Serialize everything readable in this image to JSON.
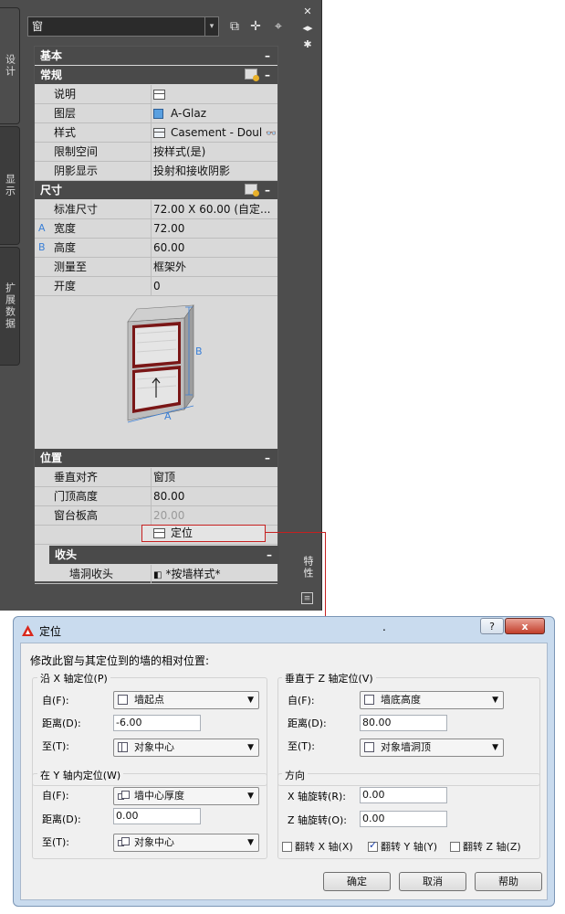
{
  "palette": {
    "type_value": "窗",
    "side_tabs": [
      "设计",
      "显示",
      "扩展数据"
    ],
    "properties_tab": "特性",
    "sections": {
      "basic": "基本",
      "general": "常规",
      "dimensions": "尺寸",
      "location": "位置",
      "sill": "收头"
    },
    "general_rows": [
      {
        "label": "说明",
        "value": ""
      },
      {
        "label": "图层",
        "value": "A-Glaz"
      },
      {
        "label": "样式",
        "value": "Casement - Doul"
      },
      {
        "label": "限制空间",
        "value": "按样式(是)"
      },
      {
        "label": "阴影显示",
        "value": "投射和接收阴影"
      }
    ],
    "dimension_rows": [
      {
        "key": "",
        "label": "标准尺寸",
        "value": "72.00  X  60.00 (自定..."
      },
      {
        "key": "A",
        "label": "宽度",
        "value": "72.00"
      },
      {
        "key": "B",
        "label": "高度",
        "value": "60.00"
      },
      {
        "key": "",
        "label": "测量至",
        "value": "框架外"
      },
      {
        "key": "",
        "label": "开度",
        "value": "0"
      }
    ],
    "preview_labels": {
      "a": "A",
      "b": "B"
    },
    "location_rows": [
      {
        "label": "垂直对齐",
        "value": "窗顶"
      },
      {
        "label": "门顶高度",
        "value": "80.00"
      },
      {
        "label": "窗台板高",
        "value": "20.00"
      }
    ],
    "location_button": "定位",
    "sill_rows": [
      {
        "label": "墙洞收头",
        "value": "*按墙样式*"
      }
    ]
  },
  "dialog": {
    "title": "定位",
    "title_dot": ".",
    "help": "?",
    "close": "x",
    "instruction": "修改此窗与其定位到的墙的相对位置:",
    "x_group": {
      "title": "沿 X 轴定位(P)",
      "from_label": "自(F):",
      "from_value": "墙起点",
      "distance_label": "距离(D):",
      "distance_value": "-6.00",
      "to_label": "至(T):",
      "to_value": "对象中心"
    },
    "z_group": {
      "title": "垂直于 Z 轴定位(V)",
      "from_label": "自(F):",
      "from_value": "墙底高度",
      "distance_label": "距离(D):",
      "distance_value": "80.00",
      "to_label": "至(T):",
      "to_value": "对象墙洞顶"
    },
    "y_group": {
      "title": "在 Y 轴内定位(W)",
      "from_label": "自(F):",
      "from_value": "墙中心厚度",
      "distance_label": "距离(D):",
      "distance_value": "0.00",
      "to_label": "至(T):",
      "to_value": "对象中心"
    },
    "direction_group": {
      "title": "方向",
      "x_rot_label": "X 轴旋转(R):",
      "x_rot_value": "0.00",
      "z_rot_label": "Z 轴旋转(O):",
      "z_rot_value": "0.00",
      "flip_x": "翻转 X 轴(X)",
      "flip_y": "翻转 Y 轴(Y)",
      "flip_z": "翻转 Z 轴(Z)",
      "flip_x_checked": false,
      "flip_y_checked": true,
      "flip_z_checked": false
    },
    "buttons": {
      "ok": "确定",
      "cancel": "取消",
      "help": "帮助"
    }
  },
  "colors": {
    "accent_red": "#c62020",
    "key_blue": "#3a7fd6",
    "section_dark": "#4a4a4a"
  }
}
